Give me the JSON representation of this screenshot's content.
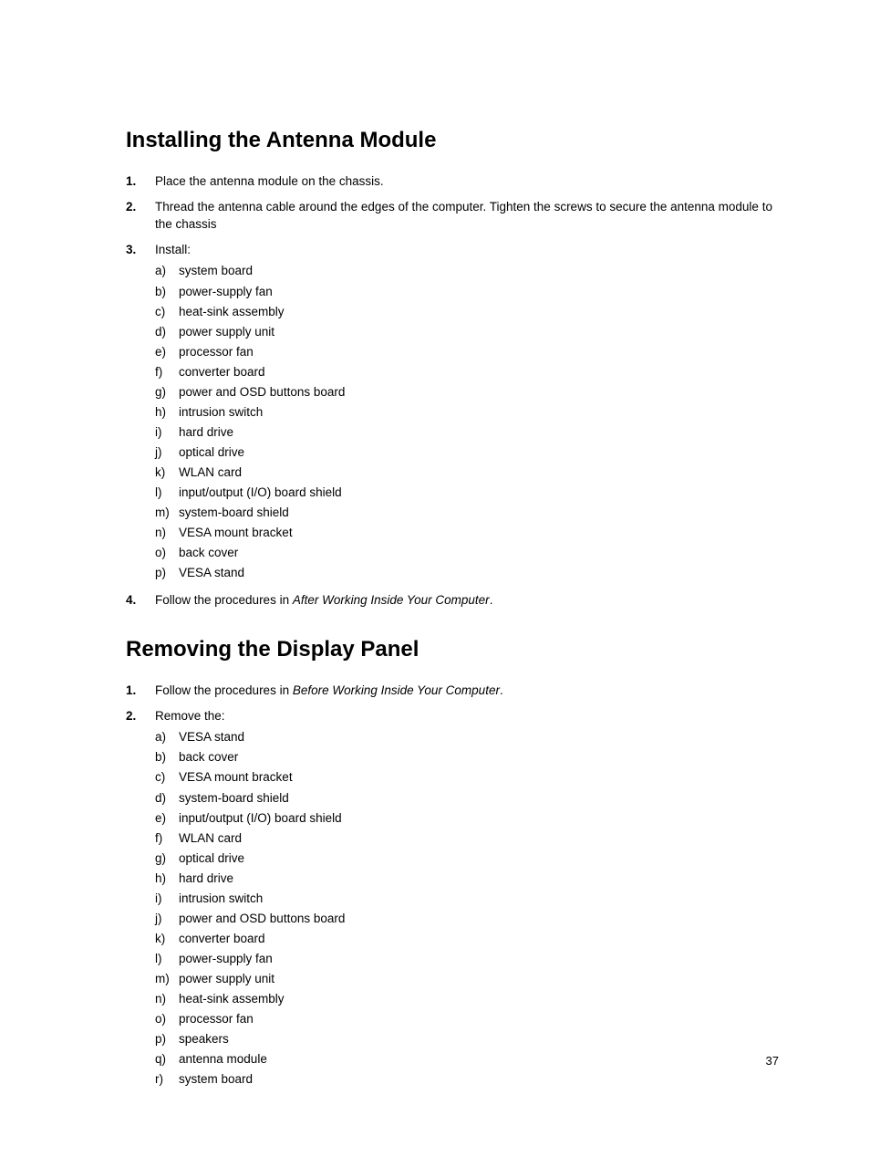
{
  "section1": {
    "heading": "Installing the Antenna Module",
    "steps": [
      {
        "num": "1.",
        "text": "Place the antenna module on the chassis.",
        "sublist": null
      },
      {
        "num": "2.",
        "text": "Thread the antenna cable around the edges of the computer. Tighten the screws to secure the antenna module to the chassis",
        "sublist": null
      },
      {
        "num": "3.",
        "text": "Install:",
        "sublist": [
          {
            "letter": "a)",
            "text": "system board"
          },
          {
            "letter": "b)",
            "text": "power-supply fan"
          },
          {
            "letter": "c)",
            "text": "heat-sink assembly"
          },
          {
            "letter": "d)",
            "text": "power supply unit"
          },
          {
            "letter": "e)",
            "text": "processor fan"
          },
          {
            "letter": "f)",
            "text": "converter board"
          },
          {
            "letter": "g)",
            "text": "power and OSD buttons board"
          },
          {
            "letter": "h)",
            "text": "intrusion switch"
          },
          {
            "letter": "i)",
            "text": "hard drive"
          },
          {
            "letter": "j)",
            "text": "optical drive"
          },
          {
            "letter": "k)",
            "text": "WLAN card"
          },
          {
            "letter": "l)",
            "text": "input/output (I/O) board shield"
          },
          {
            "letter": "m)",
            "text": "system-board shield"
          },
          {
            "letter": "n)",
            "text": "VESA mount bracket"
          },
          {
            "letter": "o)",
            "text": "back cover"
          },
          {
            "letter": "p)",
            "text": "VESA stand"
          }
        ]
      },
      {
        "num": "4.",
        "text": "Follow the procedures in ",
        "italicSuffix": "After Working Inside Your Computer",
        "suffixPeriod": ".",
        "sublist": null
      }
    ]
  },
  "section2": {
    "heading": "Removing the Display Panel",
    "steps": [
      {
        "num": "1.",
        "text": "Follow the procedures in ",
        "italicSuffix": "Before Working Inside Your Computer",
        "suffixPeriod": ".",
        "sublist": null
      },
      {
        "num": "2.",
        "text": "Remove the:",
        "sublist": [
          {
            "letter": "a)",
            "text": "VESA stand"
          },
          {
            "letter": "b)",
            "text": "back cover"
          },
          {
            "letter": "c)",
            "text": "VESA mount bracket"
          },
          {
            "letter": "d)",
            "text": "system-board shield"
          },
          {
            "letter": "e)",
            "text": "input/output (I/O) board shield"
          },
          {
            "letter": "f)",
            "text": "WLAN card"
          },
          {
            "letter": "g)",
            "text": "optical drive"
          },
          {
            "letter": "h)",
            "text": "hard drive"
          },
          {
            "letter": "i)",
            "text": "intrusion switch"
          },
          {
            "letter": "j)",
            "text": "power and OSD buttons board"
          },
          {
            "letter": "k)",
            "text": "converter board"
          },
          {
            "letter": "l)",
            "text": "power-supply fan"
          },
          {
            "letter": "m)",
            "text": "power supply unit"
          },
          {
            "letter": "n)",
            "text": "heat-sink assembly"
          },
          {
            "letter": "o)",
            "text": "processor fan"
          },
          {
            "letter": "p)",
            "text": "speakers"
          },
          {
            "letter": "q)",
            "text": "antenna module"
          },
          {
            "letter": "r)",
            "text": "system board"
          }
        ]
      }
    ]
  },
  "pageNumber": "37"
}
